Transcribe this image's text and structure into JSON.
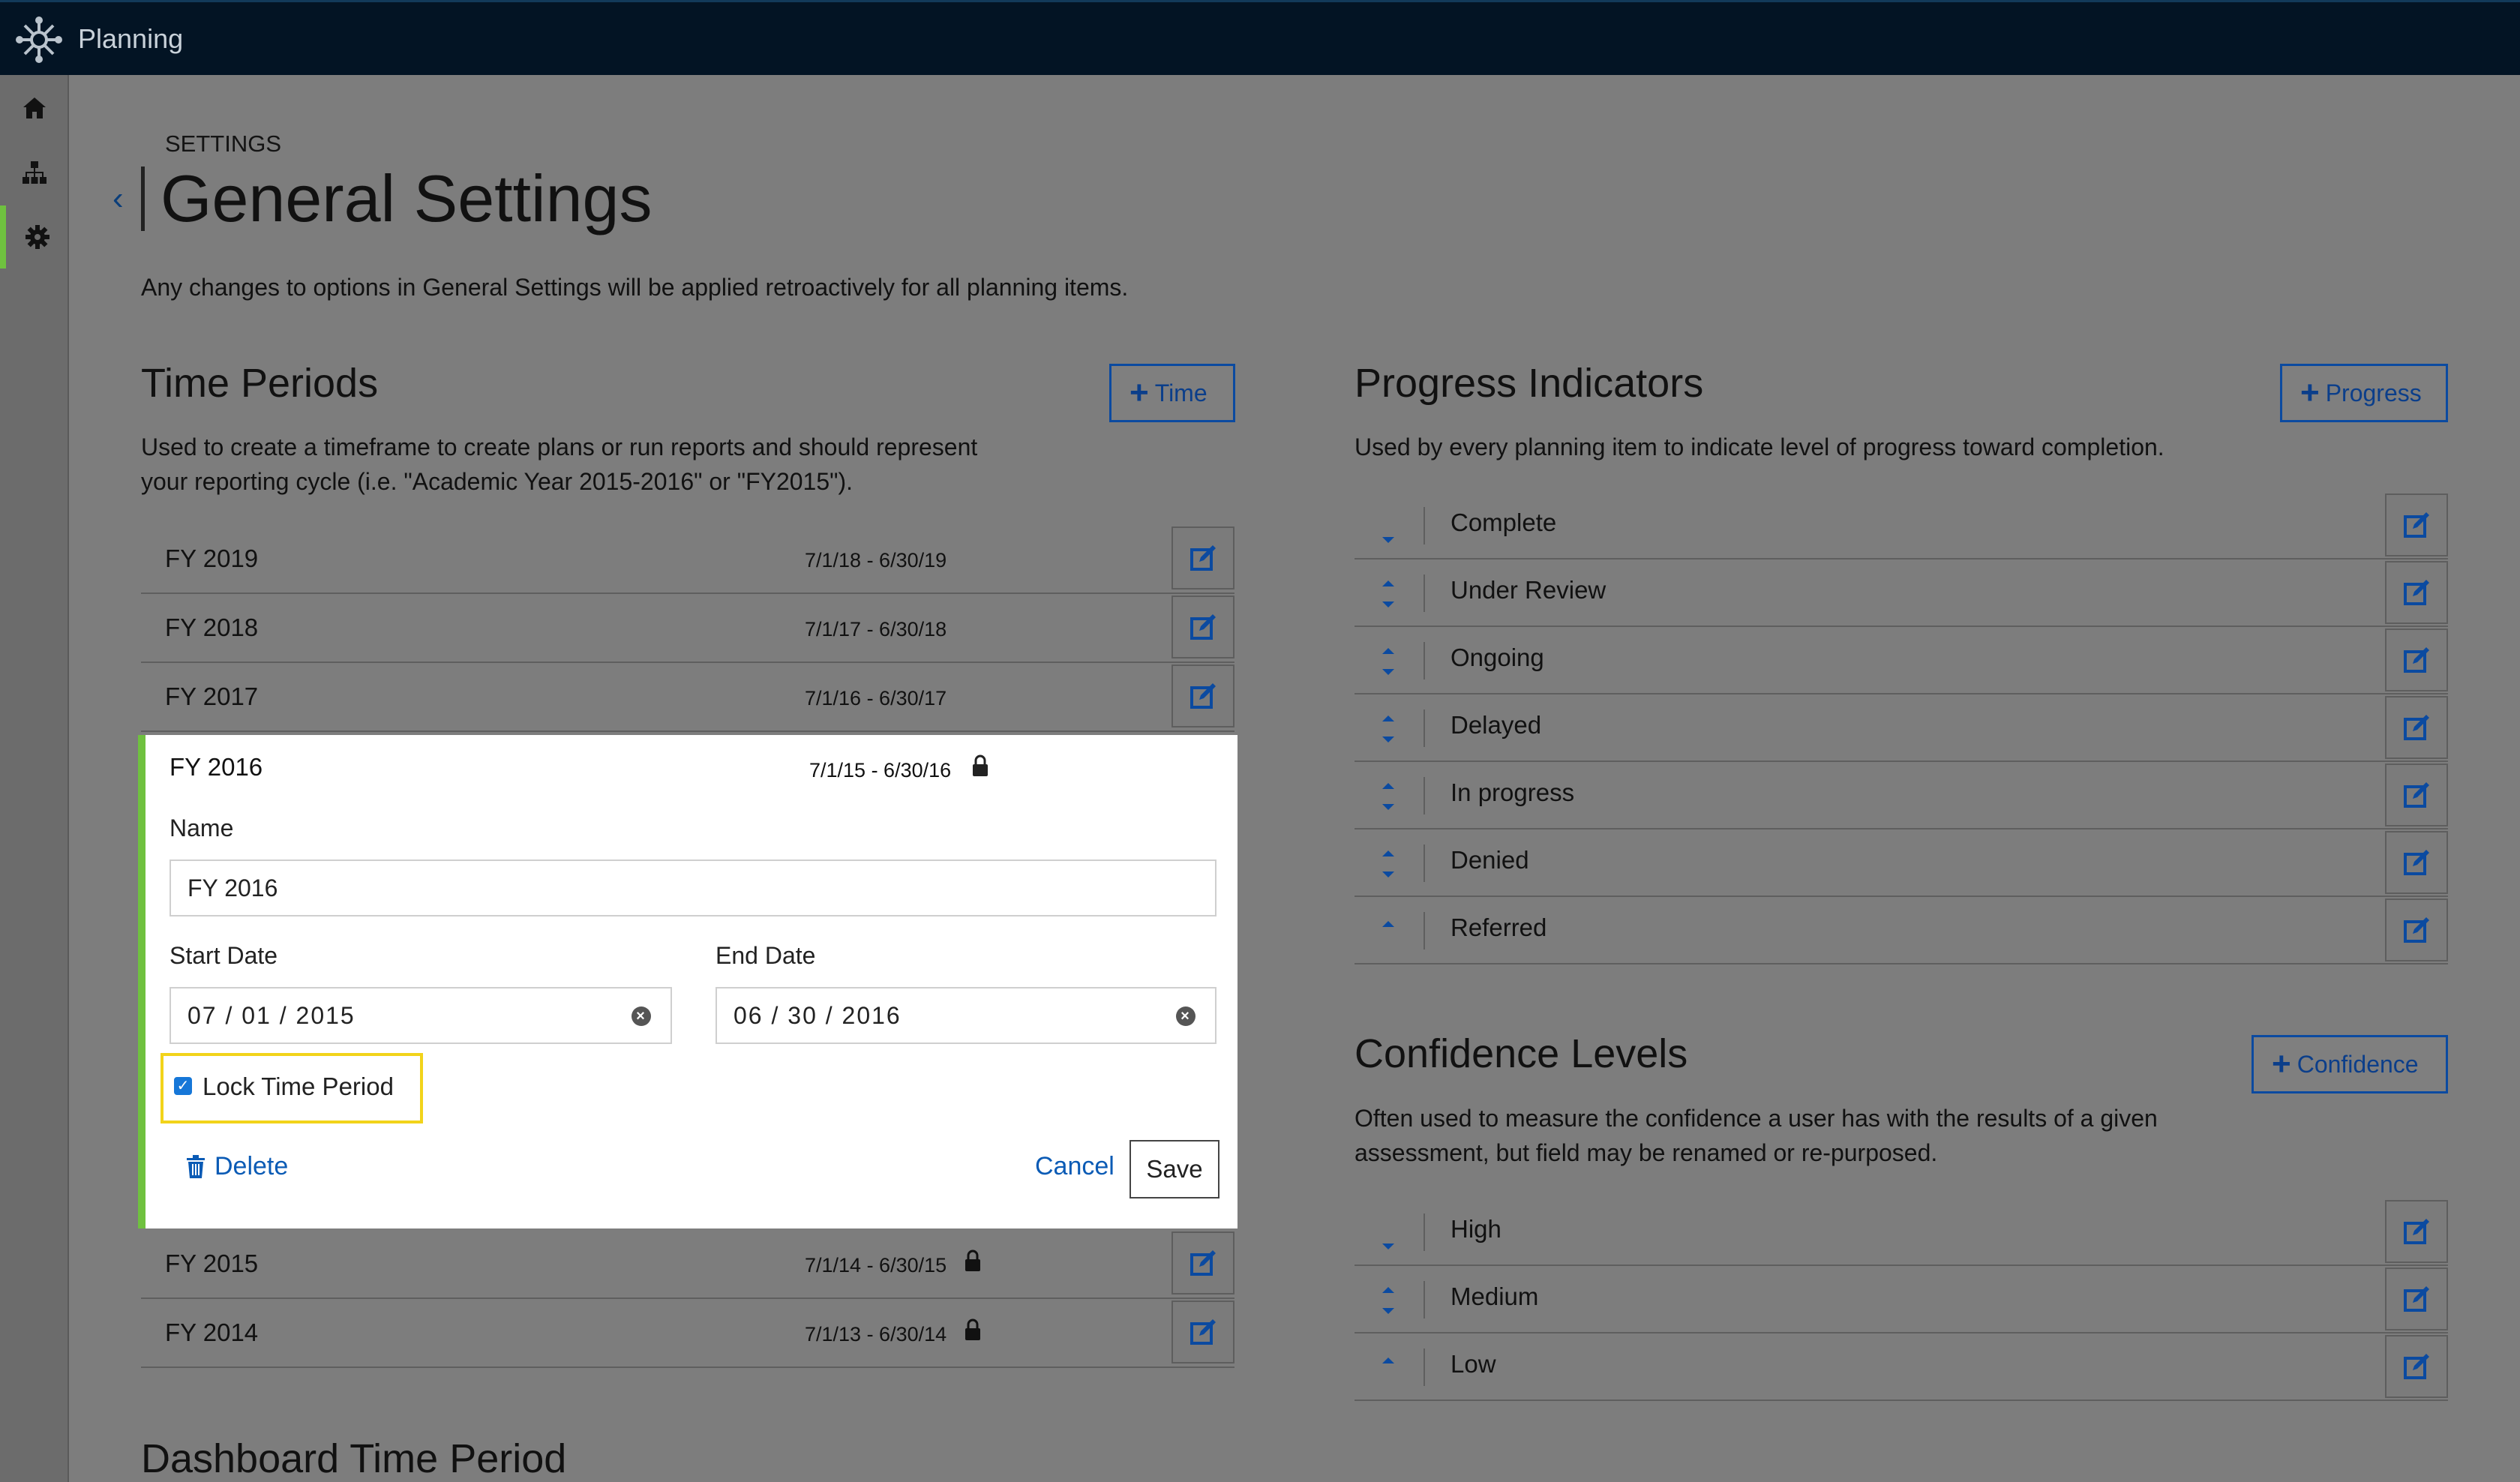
{
  "app": {
    "title": "Planning"
  },
  "sidebar": {
    "items": [
      {
        "icon": "home-icon"
      },
      {
        "icon": "org-chart-icon"
      },
      {
        "icon": "gear-icon",
        "active": true
      }
    ]
  },
  "header": {
    "breadcrumb": "SETTINGS",
    "title": "General Settings",
    "subtitle": "Any changes to options in General Settings will be applied retroactively for all planning items."
  },
  "time_periods": {
    "heading": "Time Periods",
    "add_label": "Time",
    "description_line1": "Used to create a timeframe to create plans or run reports and should represent",
    "description_line2": "your reporting cycle (i.e. \"Academic Year 2015-2016\" or \"FY2015\").",
    "rows": [
      {
        "name": "FY 2019",
        "dates": "7/1/18 - 6/30/19",
        "locked": false
      },
      {
        "name": "FY 2018",
        "dates": "7/1/17 - 6/30/18",
        "locked": false
      },
      {
        "name": "FY 2017",
        "dates": "7/1/16 - 6/30/17",
        "locked": false
      },
      {
        "name": "FY 2015",
        "dates": "7/1/14 - 6/30/15",
        "locked": true
      },
      {
        "name": "FY 2014",
        "dates": "7/1/13 - 6/30/14",
        "locked": true
      }
    ],
    "editing": {
      "name": "FY 2016",
      "dates": "7/1/15 - 6/30/16",
      "name_label": "Name",
      "name_value": "FY 2016",
      "start_label": "Start Date",
      "start_value": "07 / 01 / 2015",
      "end_label": "End Date",
      "end_value": "06 / 30 / 2016",
      "lock_label": "Lock Time Period",
      "lock_checked": true,
      "delete_label": "Delete",
      "cancel_label": "Cancel",
      "save_label": "Save"
    }
  },
  "progress": {
    "heading": "Progress Indicators",
    "add_label": "Progress",
    "description": "Used by every planning item to indicate level of progress toward completion.",
    "items": [
      "Complete",
      "Under Review",
      "Ongoing",
      "Delayed",
      "In progress",
      "Denied",
      "Referred"
    ]
  },
  "confidence": {
    "heading": "Confidence Levels",
    "add_label": "Confidence",
    "description_line1": "Often used to measure the confidence a user has with the results of a given",
    "description_line2": "assessment, but field may be renamed or re-purposed.",
    "items": [
      "High",
      "Medium",
      "Low"
    ]
  },
  "dashboard": {
    "heading": "Dashboard Time Period"
  },
  "colors": {
    "accent_green": "#6fc13f",
    "link_blue": "#0b5bb5",
    "highlight_yellow": "#f2d31a"
  }
}
